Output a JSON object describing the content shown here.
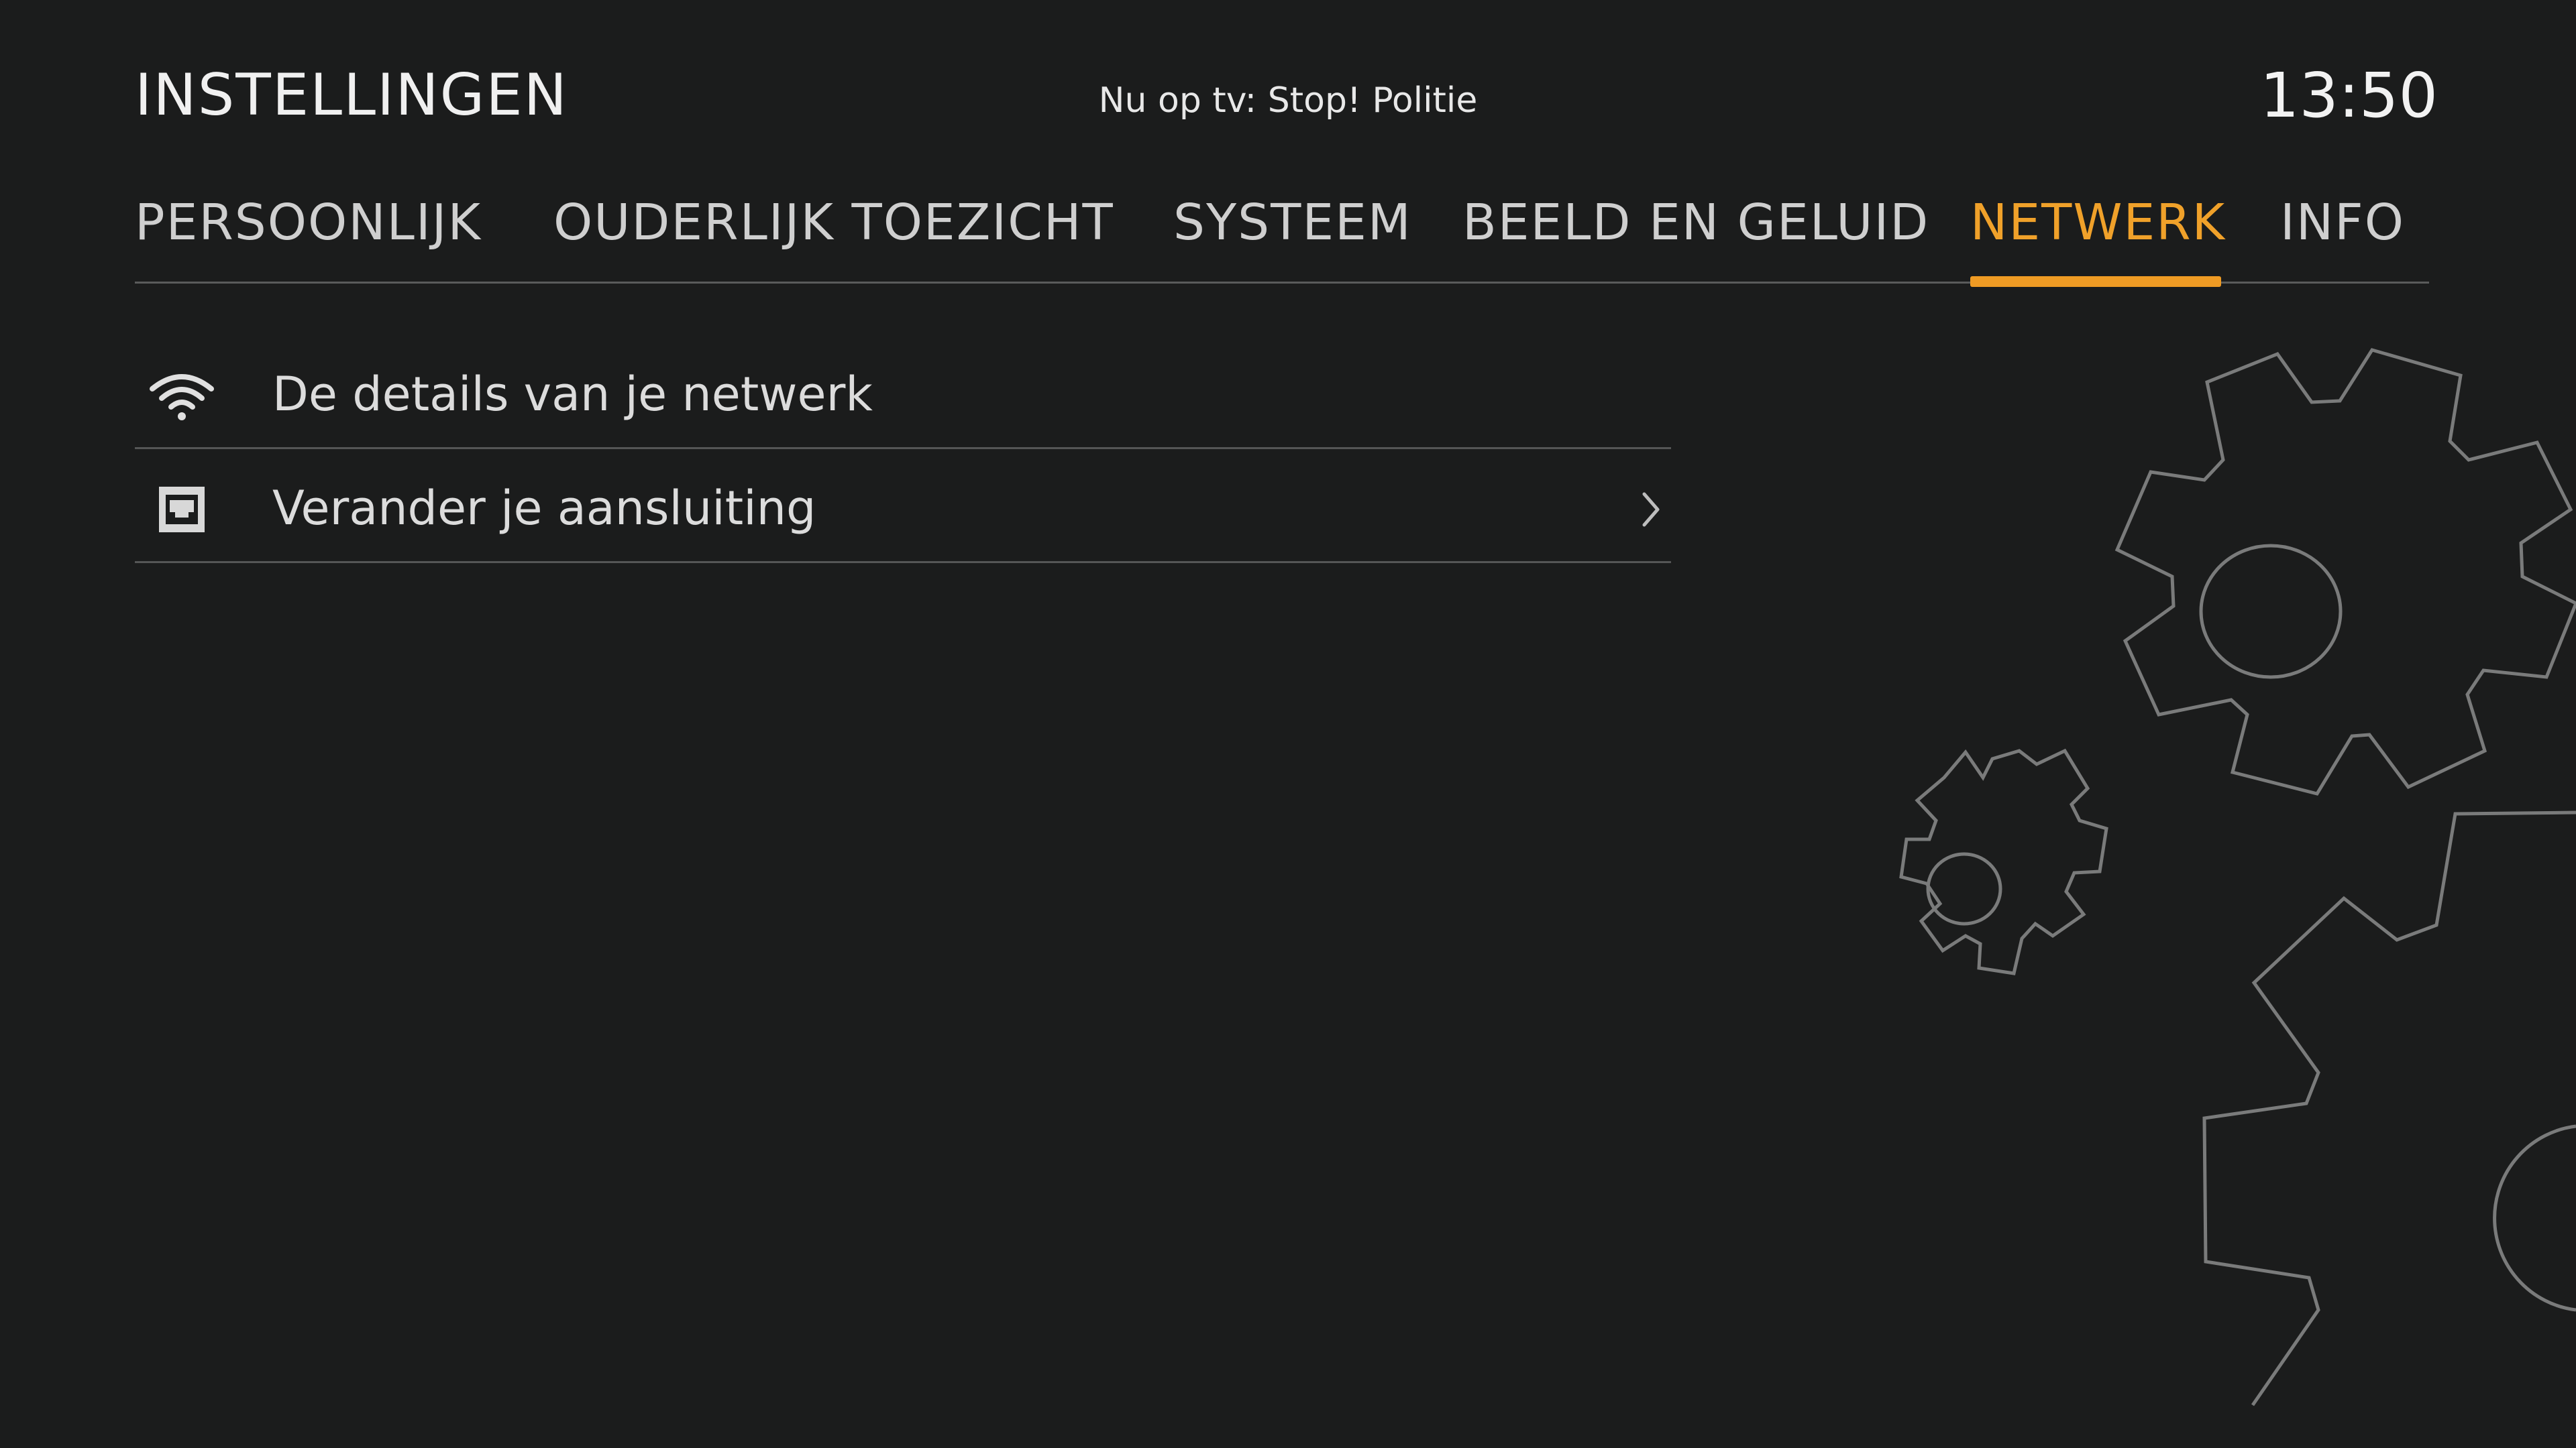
{
  "header": {
    "title": "INSTELLINGEN",
    "now_playing": "Nu op tv: Stop! Politie",
    "clock": "13:50"
  },
  "tabs": [
    {
      "label": "PERSOONLIJK",
      "active": false
    },
    {
      "label": "OUDERLIJK TOEZICHT",
      "active": false
    },
    {
      "label": "SYSTEEM",
      "active": false
    },
    {
      "label": "BEELD EN GELUID",
      "active": false
    },
    {
      "label": "NETWERK",
      "active": true
    },
    {
      "label": "INFO",
      "active": false
    }
  ],
  "menu": {
    "items": [
      {
        "label": "De details van je netwerk",
        "icon": "wifi-icon",
        "has_chevron": false
      },
      {
        "label": "Verander je aansluiting",
        "icon": "ethernet-port-icon",
        "has_chevron": true
      }
    ]
  },
  "colors": {
    "background": "#1b1c1c",
    "accent": "#ef9b24",
    "text": "#dcdcdc",
    "divider": "#555656"
  }
}
